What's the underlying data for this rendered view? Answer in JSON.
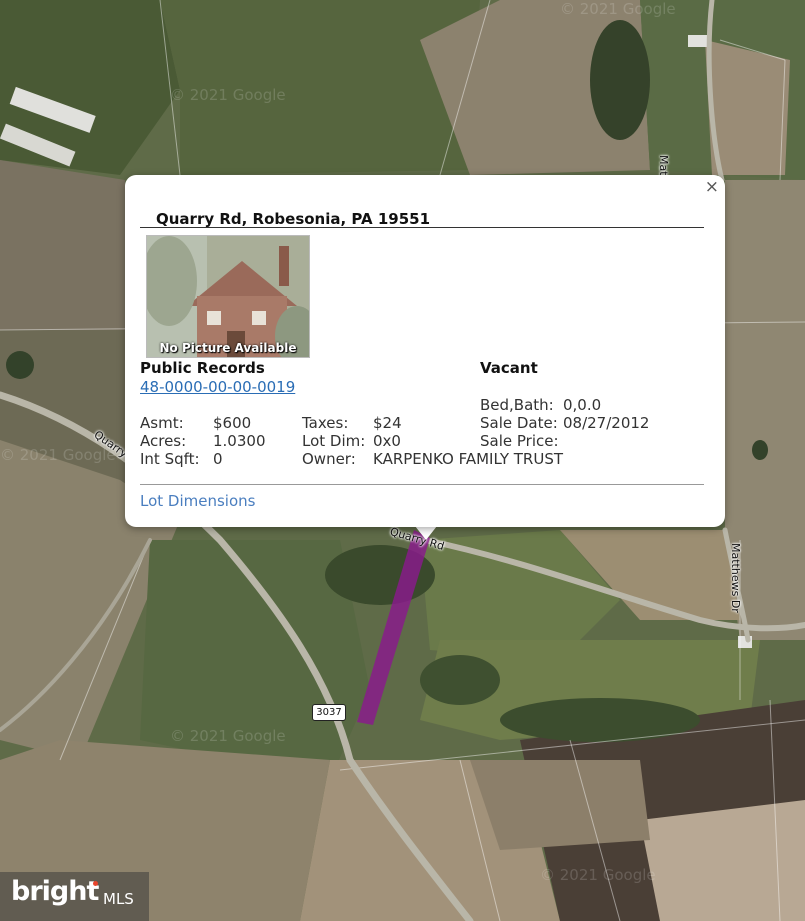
{
  "map": {
    "watermark": "© 2021 Google",
    "roads": {
      "matthews_dr": "Matthews Dr",
      "quarry_rd": "Quarry Rd",
      "route_shield": "3037"
    },
    "colors": {
      "parcel_fill": "#8a1a8c",
      "field_dark": "#4f5a3a",
      "road": "#b9b6a8"
    }
  },
  "popup": {
    "close_symbol": "×",
    "address": "Quarry Rd, Robesonia, PA 19551",
    "photo_caption": "No Picture Available",
    "public_records": {
      "title": "Public Records",
      "parcel_id": "48-0000-00-00-0019",
      "asmt_label": "Asmt:",
      "asmt_value": "$600",
      "acres_label": "Acres:",
      "acres_value": "1.0300",
      "intsqft_label": "Int Sqft:",
      "intsqft_value": "0",
      "taxes_label": "Taxes:",
      "taxes_value": "$24",
      "lotdim_label": "Lot Dim:",
      "lotdim_value": "0x0",
      "owner_label": "Owner:",
      "owner_value": "KARPENKO FAMILY TRUST"
    },
    "status": {
      "title": "Vacant",
      "bedbath_label": "Bed,Bath:",
      "bedbath_value": "0,0.0",
      "saledate_label": "Sale Date:",
      "saledate_value": "08/27/2012",
      "saleprice_label": "Sale Price:",
      "saleprice_value": ""
    },
    "lot_dimensions_link": "Lot Dimensions"
  },
  "logo": {
    "brand": "bright",
    "suffix": "MLS"
  }
}
